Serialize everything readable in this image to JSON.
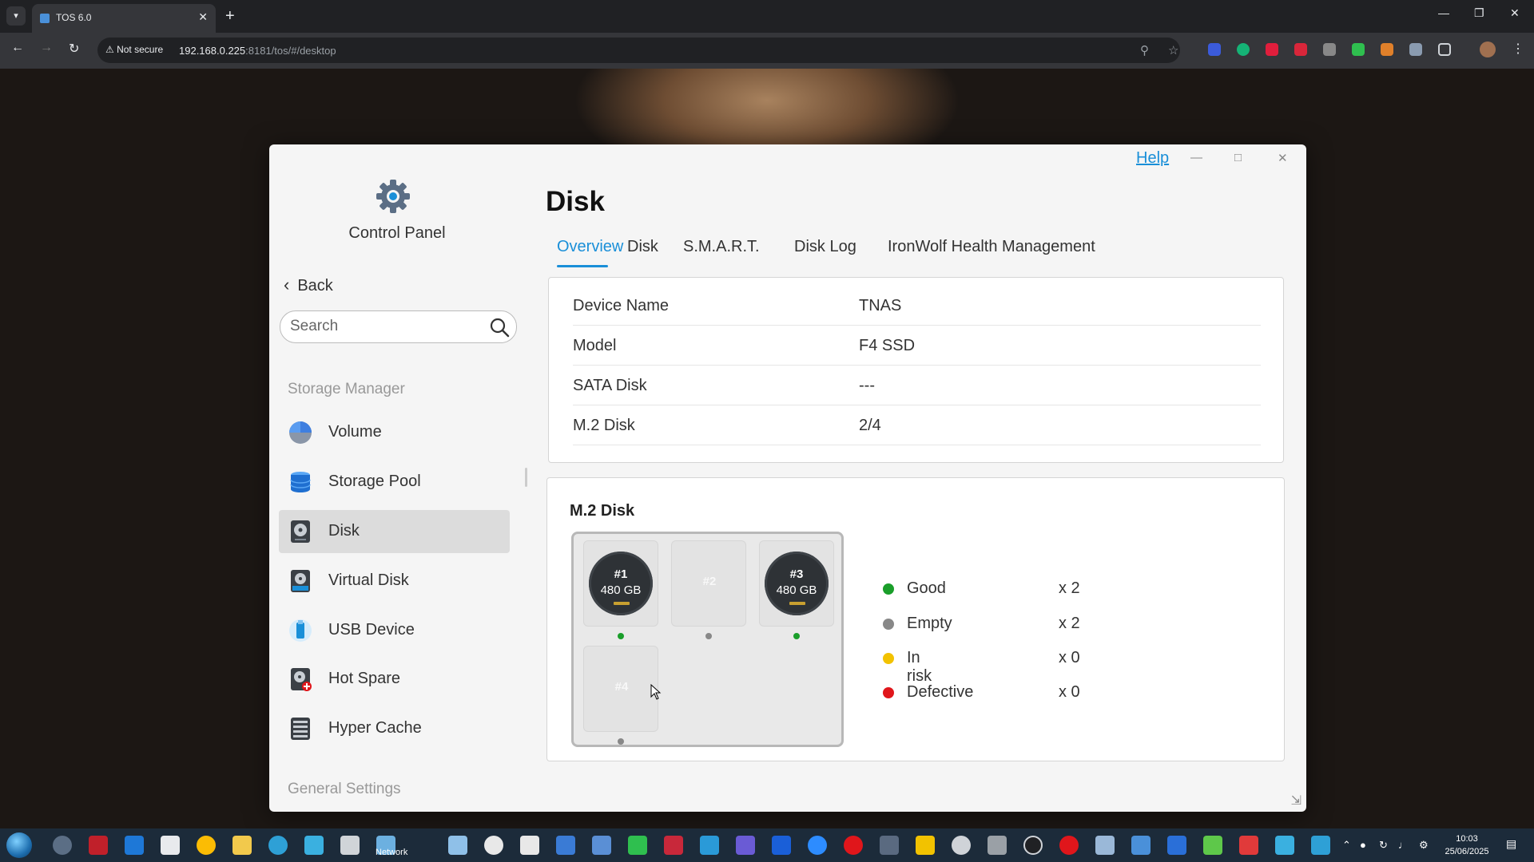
{
  "browser": {
    "tab_title": "TOS 6.0",
    "security_label": "Not secure",
    "url_host": "192.168.0.225",
    "url_path": ":8181/tos/#/desktop"
  },
  "window": {
    "help_label": "Help"
  },
  "sidebar": {
    "app_title": "Control Panel",
    "back_label": "Back",
    "search_placeholder": "Search",
    "section_storage": "Storage Manager",
    "items": [
      {
        "label": "Volume",
        "icon": "volume-pie-icon"
      },
      {
        "label": "Storage Pool",
        "icon": "storage-pool-icon"
      },
      {
        "label": "Disk",
        "icon": "disk-icon",
        "active": true
      },
      {
        "label": "Virtual Disk",
        "icon": "virtual-disk-icon"
      },
      {
        "label": "USB Device",
        "icon": "usb-device-icon"
      },
      {
        "label": "Hot Spare",
        "icon": "hot-spare-icon"
      },
      {
        "label": "Hyper Cache",
        "icon": "hyper-cache-icon"
      }
    ],
    "section_general": "General Settings"
  },
  "main": {
    "title": "Disk",
    "tabs": [
      {
        "label": "Overview",
        "active": true
      },
      {
        "label": "Disk"
      },
      {
        "label": "S.M.A.R.T."
      },
      {
        "label": "Disk Log"
      },
      {
        "label": "IronWolf Health Management"
      }
    ],
    "info": [
      {
        "label": "Device Name",
        "value": "TNAS"
      },
      {
        "label": "Model",
        "value": "F4 SSD"
      },
      {
        "label": "SATA Disk",
        "value": "---"
      },
      {
        "label": "M.2 Disk",
        "value": "2/4"
      }
    ],
    "m2": {
      "title": "M.2 Disk",
      "slots": [
        {
          "num": "#1",
          "size": "480 GB",
          "status": "good"
        },
        {
          "num": "#2",
          "size": "",
          "status": "empty"
        },
        {
          "num": "#3",
          "size": "480 GB",
          "status": "good"
        },
        {
          "num": "#4",
          "size": "",
          "status": "empty"
        }
      ],
      "legend": [
        {
          "label": "Good",
          "count": "x 2",
          "color": "#1a9e2a"
        },
        {
          "label": "Empty",
          "count": "x 2",
          "color": "#888888"
        },
        {
          "label": "In risk",
          "count": "x 0",
          "color": "#f2c200"
        },
        {
          "label": "Defective",
          "count": "x 0",
          "color": "#e0161b"
        }
      ]
    }
  },
  "taskbar": {
    "network_label": "Network",
    "time": "10:03",
    "date": "25/06/2025"
  },
  "colors": {
    "accent": "#1a8fd8",
    "good": "#1a9e2a",
    "empty": "#888888"
  }
}
